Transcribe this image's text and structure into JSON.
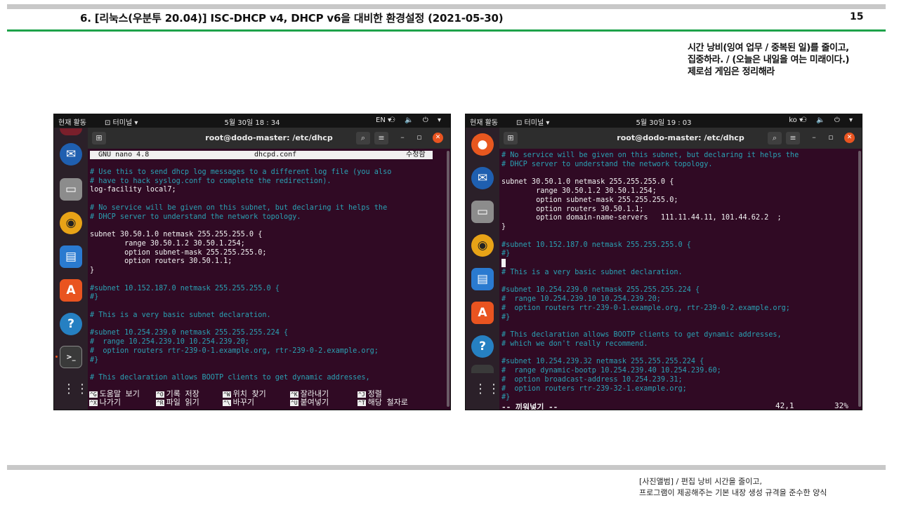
{
  "header": {
    "title": "6. [리눅스(우분투 20.04)] ISC-DHCP v4, DHCP v6을 대비한 환경설정 (2021-05-30)",
    "page_number": "15"
  },
  "quote": {
    "line1": "시간 낭비(잉여 업무 / 중복된 일)를 줄이고,",
    "line2": "집중하라. / (오늘은 내일을 여는 미래이다.)",
    "line3": "제로섬 게임은 정리해라"
  },
  "footer": {
    "line1": "[사진앨범] / 편집 낭비 시간을 줄이고,",
    "line2": "프로그램이 제공해주는 기본 내장 생성 규격을 준수한 양식"
  },
  "screenshot1": {
    "topbar": {
      "activities": "현재 활동",
      "app": "⊡ 터미널 ▾",
      "clock": "5월 30일 18 : 34",
      "lang": "EN ▾",
      "sys": "⚇ 🔈 ⏻ ▾"
    },
    "titlebar": {
      "path": "root@dodo-master: /etc/dhcp"
    },
    "nano": {
      "version": "GNU nano 4.8",
      "file": "dhcpd.conf",
      "state": "수정함"
    },
    "lines": [
      {
        "t": "",
        "c": "w"
      },
      {
        "t": "# Use this to send dhcp log messages to a different log file (you also",
        "c": "c"
      },
      {
        "t": "# have to hack syslog.conf to complete the redirection).",
        "c": "c"
      },
      {
        "t": "log-facility local7;",
        "c": "w"
      },
      {
        "t": "",
        "c": "w"
      },
      {
        "t": "# No service will be given on this subnet, but declaring it helps the",
        "c": "c"
      },
      {
        "t": "# DHCP server to understand the network topology.",
        "c": "c"
      },
      {
        "t": "",
        "c": "w"
      },
      {
        "t": "subnet 30.50.1.0 netmask 255.255.255.0 {",
        "c": "w"
      },
      {
        "t": "        range 30.50.1.2 30.50.1.254;",
        "c": "w"
      },
      {
        "t": "        option subnet-mask 255.255.255.0;",
        "c": "w"
      },
      {
        "t": "        option routers 30.50.1.1;",
        "c": "w"
      },
      {
        "t": "}",
        "c": "w"
      },
      {
        "t": "",
        "c": "w"
      },
      {
        "t": "#subnet 10.152.187.0 netmask 255.255.255.0 {",
        "c": "c"
      },
      {
        "t": "#}",
        "c": "c"
      },
      {
        "t": "",
        "c": "w"
      },
      {
        "t": "# This is a very basic subnet declaration.",
        "c": "c"
      },
      {
        "t": "",
        "c": "w"
      },
      {
        "t": "#subnet 10.254.239.0 netmask 255.255.255.224 {",
        "c": "c"
      },
      {
        "t": "#  range 10.254.239.10 10.254.239.20;",
        "c": "c"
      },
      {
        "t": "#  option routers rtr-239-0-1.example.org, rtr-239-0-2.example.org;",
        "c": "c"
      },
      {
        "t": "#}",
        "c": "c"
      },
      {
        "t": "",
        "c": "w"
      },
      {
        "t": "# This declaration allows BOOTP clients to get dynamic addresses,",
        "c": "c"
      }
    ],
    "help": [
      [
        {
          "k": "^G",
          "l": "도움말 보기"
        },
        {
          "k": "^O",
          "l": "기록 저장"
        },
        {
          "k": "^W",
          "l": "위치 찾기"
        },
        {
          "k": "^K",
          "l": "잘라내기"
        },
        {
          "k": "^J",
          "l": "정렬"
        }
      ],
      [
        {
          "k": "^X",
          "l": "나가기"
        },
        {
          "k": "^R",
          "l": "파일 읽기"
        },
        {
          "k": "^\\",
          "l": "바꾸기"
        },
        {
          "k": "^U",
          "l": "붙여넣기"
        },
        {
          "k": "^T",
          "l": "해당 철자로"
        }
      ]
    ]
  },
  "screenshot2": {
    "topbar": {
      "activities": "현재 활동",
      "app": "⊡ 터미널 ▾",
      "clock": "5월 30일 19 : 03",
      "lang": "ko ▾",
      "sys": "⚇ 🔈 ⏻ ▾"
    },
    "titlebar": {
      "path": "root@dodo-master: /etc/dhcp"
    },
    "lines": [
      {
        "t": "# No service will be given on this subnet, but declaring it helps the",
        "c": "c"
      },
      {
        "t": "# DHCP server to understand the network topology.",
        "c": "c"
      },
      {
        "t": "",
        "c": "w"
      },
      {
        "t": "subnet 30.50.1.0 netmask 255.255.255.0 {",
        "c": "w"
      },
      {
        "t": "        range 30.50.1.2 30.50.1.254;",
        "c": "w"
      },
      {
        "t": "        option subnet-mask 255.255.255.0;",
        "c": "w"
      },
      {
        "t": "        option routers 30.50.1.1;",
        "c": "w"
      },
      {
        "t": "        option domain-name-servers   111.11.44.11, 101.44.62.2  ;",
        "c": "w"
      },
      {
        "t": "}",
        "c": "w"
      },
      {
        "t": "",
        "c": "w"
      },
      {
        "t": "#subnet 10.152.187.0 netmask 255.255.255.0 {",
        "c": "c"
      },
      {
        "t": "#}",
        "c": "c"
      },
      {
        "t": "",
        "c": "cursor"
      },
      {
        "t": "# This is a very basic subnet declaration.",
        "c": "c"
      },
      {
        "t": "",
        "c": "w"
      },
      {
        "t": "#subnet 10.254.239.0 netmask 255.255.255.224 {",
        "c": "c"
      },
      {
        "t": "#  range 10.254.239.10 10.254.239.20;",
        "c": "c"
      },
      {
        "t": "#  option routers rtr-239-0-1.example.org, rtr-239-0-2.example.org;",
        "c": "c"
      },
      {
        "t": "#}",
        "c": "c"
      },
      {
        "t": "",
        "c": "w"
      },
      {
        "t": "# This declaration allows BOOTP clients to get dynamic addresses,",
        "c": "c"
      },
      {
        "t": "# which we don't really recommend.",
        "c": "c"
      },
      {
        "t": "",
        "c": "w"
      },
      {
        "t": "#subnet 10.254.239.32 netmask 255.255.255.224 {",
        "c": "c"
      },
      {
        "t": "#  range dynamic-bootp 10.254.239.40 10.254.239.60;",
        "c": "c"
      },
      {
        "t": "#  option broadcast-address 10.254.239.31;",
        "c": "c"
      },
      {
        "t": "#  option routers rtr-239-32-1.example.org;",
        "c": "c"
      },
      {
        "t": "#}",
        "c": "c"
      }
    ],
    "status": {
      "mode": "-- 끼워넣기 --",
      "position": "42,1",
      "percent": "32%"
    }
  },
  "colors": {
    "accent_green": "#1ea24a",
    "terminal_bg": "#300a24",
    "comment": "#2aa1b3",
    "ubuntu_orange": "#e95420"
  }
}
